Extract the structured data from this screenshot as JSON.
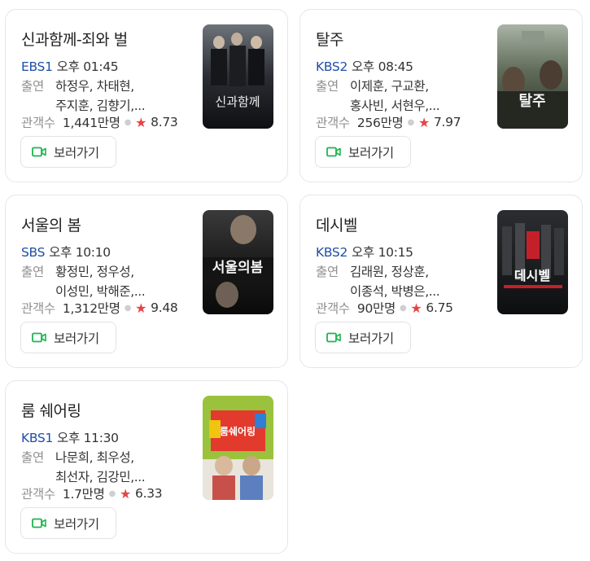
{
  "button_label": "보러가기",
  "cast_label": "출연",
  "audience_label": "관객수",
  "cards": [
    {
      "title": "신과함께-죄와 벌",
      "channel": "EBS1",
      "airtime": "오후 01:45",
      "cast_line1": "하정우, 차태현,",
      "cast_line2": "주지훈, 김향기,...",
      "audience": "1,441만명",
      "rating": "8.73",
      "poster_text": "신과함께"
    },
    {
      "title": "탈주",
      "channel": "KBS2",
      "airtime": "오후 08:45",
      "cast_line1": "이제훈, 구교환,",
      "cast_line2": "홍사빈, 서현우,...",
      "audience": "256만명",
      "rating": "7.97",
      "poster_text": "탈주"
    },
    {
      "title": "서울의 봄",
      "channel": "SBS",
      "airtime": "오후 10:10",
      "cast_line1": "황정민, 정우성,",
      "cast_line2": "이성민, 박해준,...",
      "audience": "1,312만명",
      "rating": "9.48",
      "poster_text": "서울의봄"
    },
    {
      "title": "데시벨",
      "channel": "KBS2",
      "airtime": "오후 10:15",
      "cast_line1": "김래원, 정상훈,",
      "cast_line2": "이종석, 박병은,...",
      "audience": "90만명",
      "rating": "6.75",
      "poster_text": "데시벨"
    },
    {
      "title": "룸 쉐어링",
      "channel": "KBS1",
      "airtime": "오후 11:30",
      "cast_line1": "나문희, 최우성,",
      "cast_line2": "최선자, 김강민,...",
      "audience": "1.7만명",
      "rating": "6.33",
      "poster_text": "룸쉐어링"
    }
  ],
  "colors": {
    "channel": "#1f4fa6",
    "star": "#e64545",
    "video_icon": "#1eb44f",
    "border": "#e6e6ea"
  },
  "icons": {
    "star": "star-icon",
    "video": "video-camera-icon"
  }
}
